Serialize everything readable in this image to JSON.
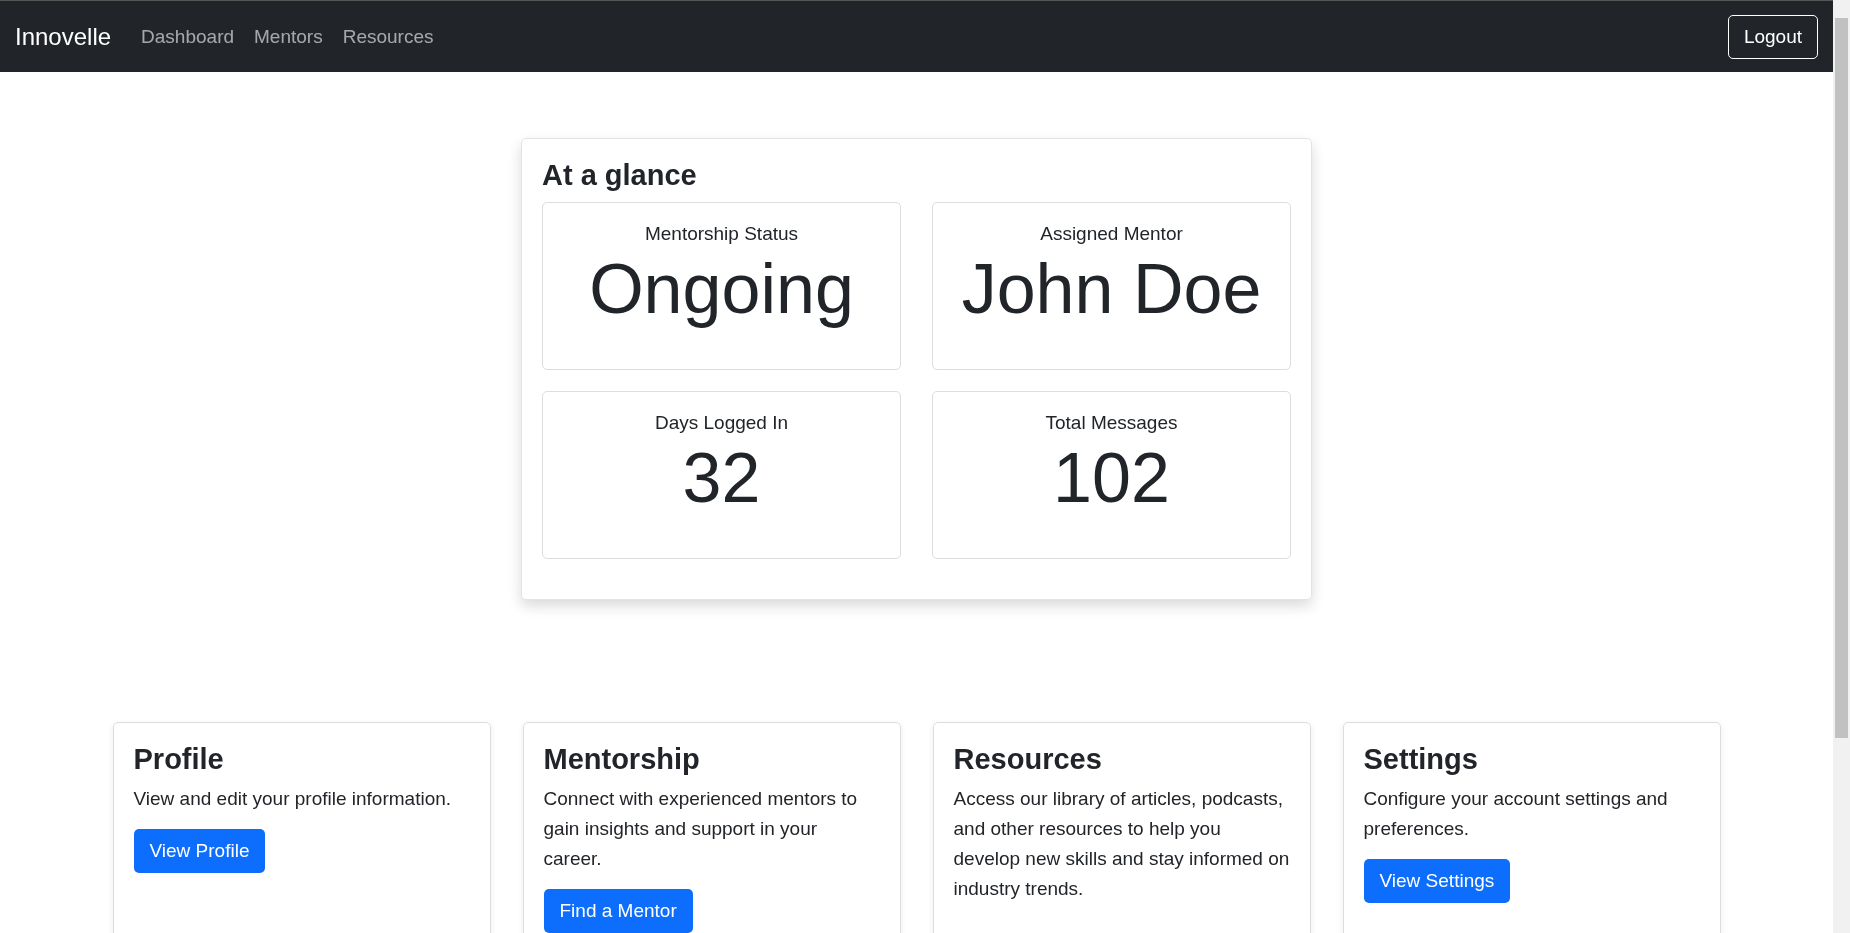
{
  "navbar": {
    "brand": "Innovelle",
    "links": [
      {
        "label": "Dashboard"
      },
      {
        "label": "Mentors"
      },
      {
        "label": "Resources"
      }
    ],
    "logout": "Logout"
  },
  "glance": {
    "title": "At a glance",
    "stats": [
      {
        "label": "Mentorship Status",
        "value": "Ongoing"
      },
      {
        "label": "Assigned Mentor",
        "value": "John Doe"
      },
      {
        "label": "Days Logged In",
        "value": "32"
      },
      {
        "label": "Total Messages",
        "value": "102"
      }
    ]
  },
  "cards": [
    {
      "title": "Profile",
      "text": "View and edit your profile information.",
      "button": "View Profile"
    },
    {
      "title": "Mentorship",
      "text": "Connect with experienced mentors to gain insights and support in your career.",
      "button": "Find a Mentor"
    },
    {
      "title": "Resources",
      "text": "Access our library of articles, podcasts, and other resources to help you develop new skills and stay informed on industry trends."
    },
    {
      "title": "Settings",
      "text": "Configure your account settings and preferences.",
      "button": "View Settings"
    }
  ]
}
